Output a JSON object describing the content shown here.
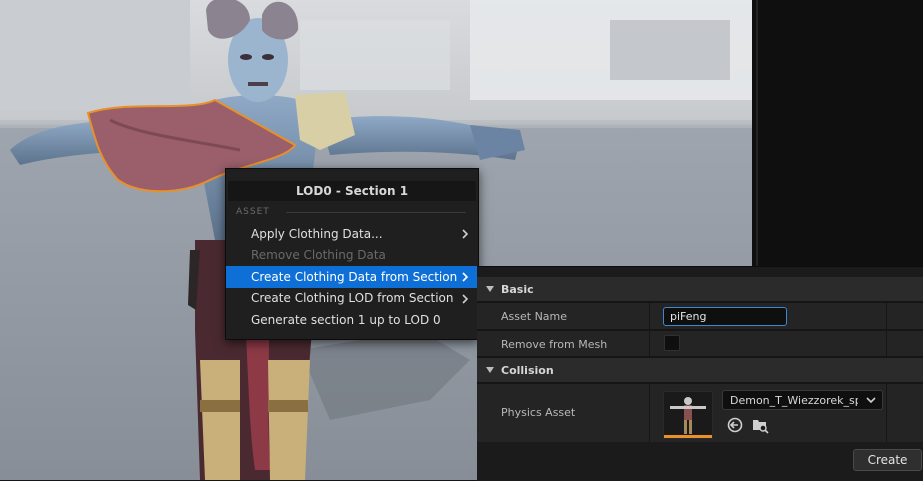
{
  "context_menu": {
    "title": "LOD0 - Section 1",
    "section_label": "ASSET",
    "items": [
      {
        "label": "Apply Clothing Data...",
        "enabled": true,
        "submenu": true,
        "highlighted": false
      },
      {
        "label": "Remove Clothing Data",
        "enabled": false,
        "submenu": false,
        "highlighted": false
      },
      {
        "label": "Create Clothing Data from Section",
        "enabled": true,
        "submenu": true,
        "highlighted": true
      },
      {
        "label": "Create Clothing LOD from Section",
        "enabled": true,
        "submenu": true,
        "highlighted": false
      },
      {
        "label": "Generate section 1 up to LOD 0",
        "enabled": true,
        "submenu": false,
        "highlighted": false
      }
    ]
  },
  "details": {
    "basic": {
      "title": "Basic",
      "asset_name_label": "Asset Name",
      "asset_name_value": "piFeng",
      "remove_from_mesh_label": "Remove from Mesh",
      "remove_from_mesh_checked": false
    },
    "collision": {
      "title": "Collision",
      "physics_asset_label": "Physics Asset",
      "physics_asset_value": "Demon_T_Wiezzorek_spli"
    },
    "create_label": "Create"
  },
  "icons": {
    "category_expand": "triangle-down-icon",
    "submenu": "chevron-right-icon",
    "combo": "chevron-down-icon",
    "use_selected": "arrow-left-circle-icon",
    "browse": "folder-search-icon"
  },
  "colors": {
    "highlight": "#0e70d6",
    "input_focus": "#3e86d6",
    "selection_outline": "#e8902a"
  }
}
